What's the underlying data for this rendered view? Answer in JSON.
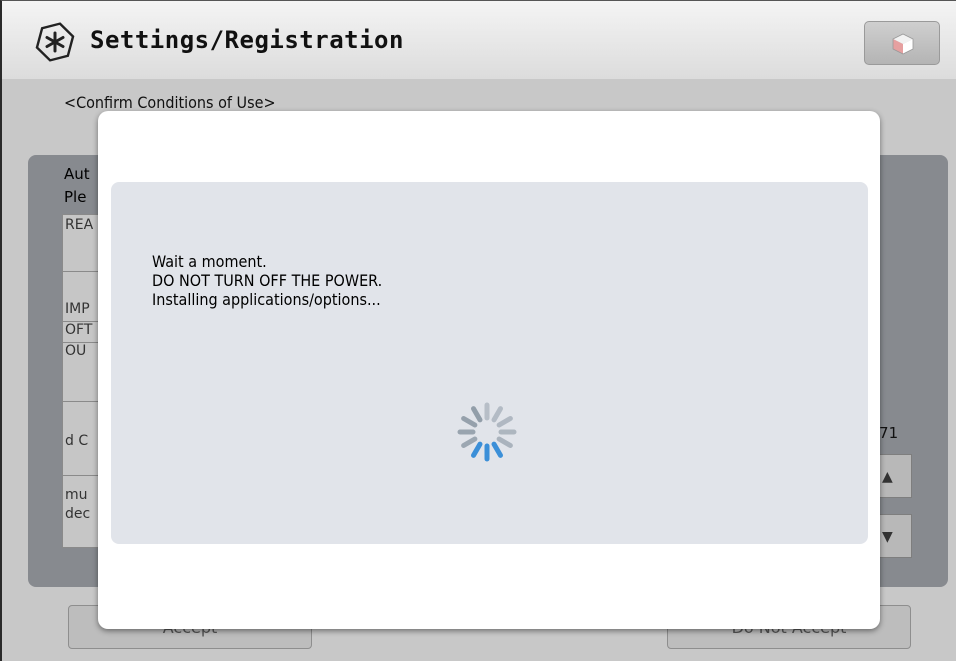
{
  "header": {
    "title": "Settings/Registration",
    "icon": "settings-asterisk-icon",
    "right_button_icon": "cube-icon"
  },
  "background": {
    "subtitle": "<Confirm Conditions of Use>",
    "label_1": "Aut",
    "label_2": "Ple",
    "rows": [
      "REA",
      "IMP",
      "OFT",
      "OU",
      "d C",
      "mu",
      "dec"
    ],
    "page_counter": "/71",
    "up_button_icon": "arrow-up-icon",
    "down_button_icon": "arrow-down-icon",
    "accept_label": "Accept",
    "do_not_accept_label": "Do Not Accept"
  },
  "dialog": {
    "lines": [
      "Wait a moment.",
      "DO NOT TURN OFF THE POWER.",
      "Installing applications/options..."
    ],
    "spinner_icon": "loading-spinner-icon"
  },
  "colors": {
    "spinner_blue": "#3b8fd8",
    "spinner_grey": "#8e9aa6",
    "panel_bg": "#e1e4ea"
  }
}
